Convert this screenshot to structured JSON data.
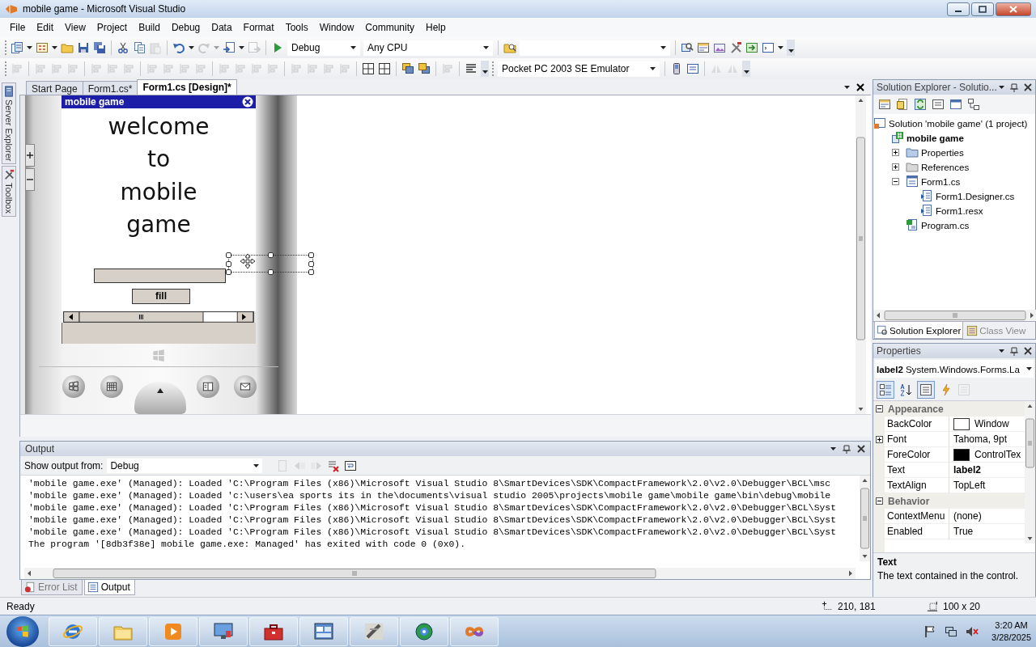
{
  "window": {
    "title": "mobile game - Microsoft Visual Studio"
  },
  "menu": [
    "File",
    "Edit",
    "View",
    "Project",
    "Build",
    "Debug",
    "Data",
    "Format",
    "Tools",
    "Window",
    "Community",
    "Help"
  ],
  "toolbar": {
    "configuration": "Debug",
    "platform": "Any CPU",
    "device": "Pocket PC 2003 SE Emulator"
  },
  "side_tabs": [
    {
      "label": "Server Explorer"
    },
    {
      "label": "Toolbox"
    }
  ],
  "document_tabs": [
    {
      "label": "Start Page",
      "selected": false
    },
    {
      "label": "Form1.cs*",
      "selected": false
    },
    {
      "label": "Form1.cs [Design]*",
      "selected": true
    }
  ],
  "designer": {
    "form_title": "mobile game",
    "label": "welcome\nto\nmobile\ngame",
    "button": "fill"
  },
  "solution_explorer": {
    "title": "Solution Explorer - Solutio...",
    "tree": [
      {
        "label": "Solution 'mobile game' (1 project)",
        "kind": "solution",
        "children": [
          {
            "label": "mobile game",
            "kind": "project",
            "children": [
              {
                "label": "Properties",
                "kind": "properties",
                "expanded": false
              },
              {
                "label": "References",
                "kind": "references",
                "expanded": false
              },
              {
                "label": "Form1.cs",
                "kind": "form",
                "expanded": true,
                "children": [
                  {
                    "label": "Form1.Designer.cs",
                    "kind": "file"
                  },
                  {
                    "label": "Form1.resx",
                    "kind": "file"
                  }
                ]
              },
              {
                "label": "Program.cs",
                "kind": "code"
              }
            ]
          }
        ]
      }
    ],
    "tabs": [
      {
        "label": "Solution Explorer",
        "selected": true
      },
      {
        "label": "Class View",
        "selected": false
      }
    ]
  },
  "properties": {
    "title": "Properties",
    "object": "label2",
    "object_type": "System.Windows.Forms.La",
    "categories": [
      {
        "name": "Appearance",
        "expanded": true,
        "rows": [
          {
            "name": "BackColor",
            "value": "Window",
            "color": "#ffffff",
            "modified": false
          },
          {
            "name": "Font",
            "value": "Tahoma, 9pt",
            "expanded": false,
            "modified": false
          },
          {
            "name": "ForeColor",
            "value": "ControlTex",
            "color": "#000000",
            "modified": false
          },
          {
            "name": "Text",
            "value": "label2",
            "modified": true
          },
          {
            "name": "TextAlign",
            "value": "TopLeft",
            "modified": false
          }
        ]
      },
      {
        "name": "Behavior",
        "expanded": true,
        "rows": [
          {
            "name": "ContextMenu",
            "value": "(none)",
            "modified": false
          },
          {
            "name": "Enabled",
            "value": "True",
            "modified": false
          }
        ]
      }
    ],
    "description": {
      "title": "Text",
      "text": "The text contained in the control."
    }
  },
  "output": {
    "title": "Output",
    "source_label": "Show output from:",
    "source": "Debug",
    "lines": [
      "'mobile game.exe' (Managed): Loaded 'C:\\Program Files (x86)\\Microsoft Visual Studio 8\\SmartDevices\\SDK\\CompactFramework\\2.0\\v2.0\\Debugger\\BCL\\msc",
      "'mobile game.exe' (Managed): Loaded 'c:\\users\\ea sports its in the\\documents\\visual studio 2005\\projects\\mobile game\\mobile game\\bin\\debug\\mobile",
      "'mobile game.exe' (Managed): Loaded 'C:\\Program Files (x86)\\Microsoft Visual Studio 8\\SmartDevices\\SDK\\CompactFramework\\2.0\\v2.0\\Debugger\\BCL\\Syst",
      "'mobile game.exe' (Managed): Loaded 'C:\\Program Files (x86)\\Microsoft Visual Studio 8\\SmartDevices\\SDK\\CompactFramework\\2.0\\v2.0\\Debugger\\BCL\\Syst",
      "'mobile game.exe' (Managed): Loaded 'C:\\Program Files (x86)\\Microsoft Visual Studio 8\\SmartDevices\\SDK\\CompactFramework\\2.0\\v2.0\\Debugger\\BCL\\Syst",
      "The program '[8db3f38e] mobile game.exe: Managed' has exited with code 0 (0x0)."
    ]
  },
  "bottom_tabs": [
    {
      "label": "Error List",
      "selected": false
    },
    {
      "label": "Output",
      "selected": true
    }
  ],
  "status_bar": {
    "text": "Ready",
    "position": "210, 181",
    "size": "100 x 20"
  },
  "taskbar": {
    "time": "3:20 AM",
    "date": "3/28/2025"
  }
}
